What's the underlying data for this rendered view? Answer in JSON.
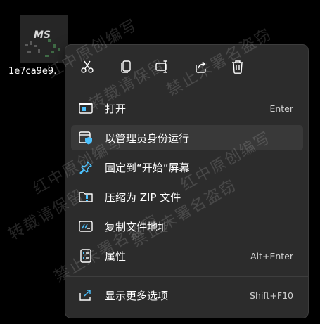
{
  "desktop": {
    "file_name": "1e7ca9e9.",
    "thumb_text": "MS"
  },
  "toolbar": {
    "buttons": [
      {
        "icon": "cut-icon"
      },
      {
        "icon": "copy-icon"
      },
      {
        "icon": "rename-icon"
      },
      {
        "icon": "share-icon"
      },
      {
        "icon": "delete-icon"
      }
    ]
  },
  "menu": {
    "items": [
      {
        "label": "打开",
        "shortcut": "Enter",
        "icon": "open-icon"
      },
      {
        "label": "以管理员身份运行",
        "shortcut": "",
        "icon": "run-as-admin-icon"
      },
      {
        "label": "固定到“开始”屏幕",
        "shortcut": "",
        "icon": "pin-icon"
      },
      {
        "label": "压缩为 ZIP 文件",
        "shortcut": "",
        "icon": "zip-folder-icon"
      },
      {
        "label": "复制文件地址",
        "shortcut": "",
        "icon": "copy-path-icon"
      },
      {
        "label": "属性",
        "shortcut": "Alt+Enter",
        "icon": "properties-icon"
      },
      {
        "label": "显示更多选项",
        "shortcut": "Shift+F10",
        "icon": "more-options-icon"
      }
    ]
  },
  "watermarks": [
    "红中原创编写",
    "转载请保留",
    "禁止未署名盗窃"
  ],
  "colors": {
    "accent": "#4cc2ff",
    "menu_bg": "#2c2c2c",
    "hover_bg": "#393939",
    "desktop_bg": "#000000"
  }
}
